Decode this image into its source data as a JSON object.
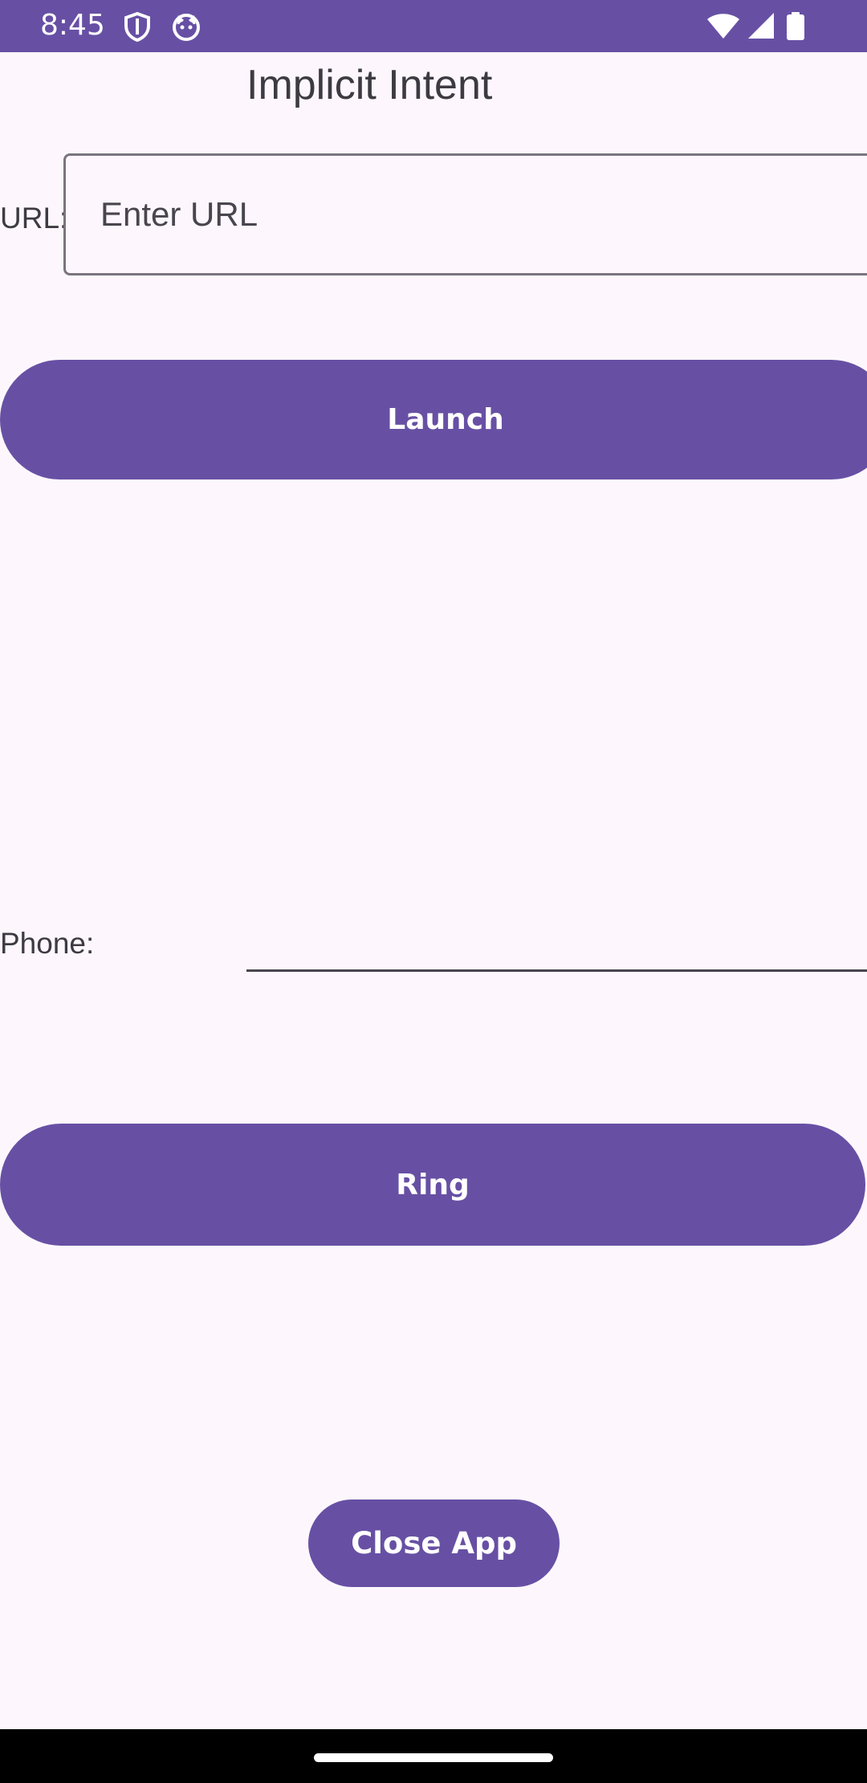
{
  "status_bar": {
    "time": "8:45",
    "left_icons": [
      "shield-icon",
      "cat-icon"
    ],
    "right_icons": [
      "wifi-icon",
      "signal-icon",
      "battery-icon"
    ]
  },
  "page": {
    "title": "Implicit Intent"
  },
  "url_row": {
    "label": "URL:",
    "placeholder": "Enter URL",
    "value": ""
  },
  "launch_button": {
    "label": "Launch"
  },
  "phone_row": {
    "label": "Phone:",
    "value": ""
  },
  "ring_button": {
    "label": "Ring"
  },
  "close_button": {
    "label": "Close App"
  },
  "colors": {
    "primary": "#6750a4",
    "background": "#fdf7fd",
    "text": "#3d3a42",
    "outline": "#79747e",
    "on_primary": "#ffffff"
  }
}
